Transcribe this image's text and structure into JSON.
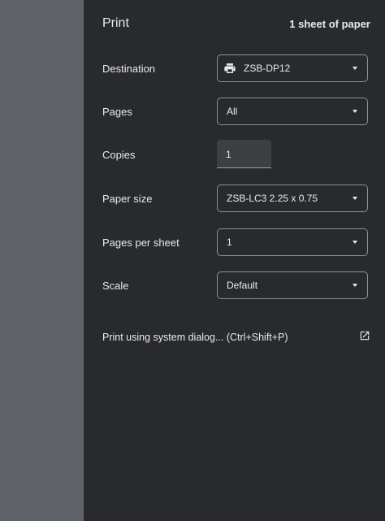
{
  "header": {
    "title": "Print",
    "summary": "1 sheet of paper"
  },
  "settings": {
    "destination": {
      "label": "Destination",
      "value": "ZSB-DP12",
      "icon": "printer-icon"
    },
    "pages": {
      "label": "Pages",
      "value": "All"
    },
    "copies": {
      "label": "Copies",
      "value": "1"
    },
    "paper_size": {
      "label": "Paper size",
      "value": "ZSB-LC3 2.25 x 0.75"
    },
    "pages_per_sheet": {
      "label": "Pages per sheet",
      "value": "1"
    },
    "scale": {
      "label": "Scale",
      "value": "Default"
    }
  },
  "system_dialog": {
    "label": "Print using system dialog... (Ctrl+Shift+P)",
    "icon": "open-in-new-icon"
  },
  "colors": {
    "panel_background": "#292a2d",
    "preview_background": "#5f6368",
    "text": "#e8eaed",
    "field_border": "#8e9196",
    "input_background": "#3c4043"
  }
}
